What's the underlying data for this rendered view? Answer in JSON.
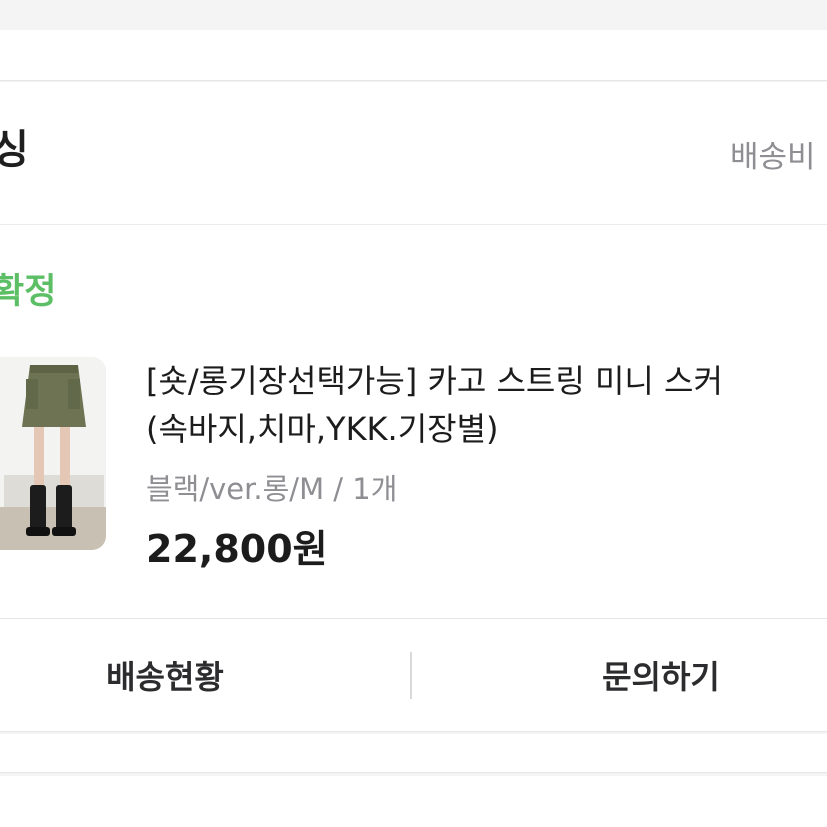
{
  "store": {
    "name": "싱",
    "shipping_fee_label": "배송비"
  },
  "order": {
    "status": "확정",
    "product": {
      "title_line1": "[숏/롱기장선택가능] 카고 스트링 미니 스커",
      "title_line2": "(속바지,치마,YKK.기장별)",
      "option": "블랙/ver.롱/M / 1개",
      "price": "22,800원",
      "thumbnail_icon": "product-photo-skirt"
    }
  },
  "actions": {
    "delivery_status": "배송현황",
    "inquiry": "문의하기"
  },
  "colors": {
    "status_green": "#5cbf66",
    "text_primary": "#1c1c1c",
    "text_secondary": "#8e8e93",
    "background": "#f4f4f5"
  }
}
